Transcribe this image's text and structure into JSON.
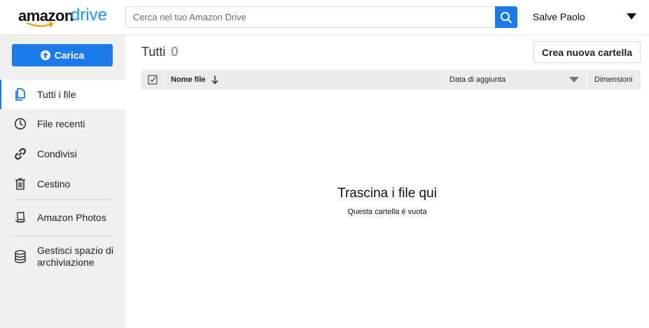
{
  "header": {
    "logo_amazon": "amazon",
    "logo_drive": "drive",
    "search_placeholder": "Cerca nel tuo Amazon Drive",
    "greeting": "Salve Paolo"
  },
  "sidebar": {
    "upload_label": "Carica",
    "items": [
      {
        "label": "Tutti i file",
        "icon": "files-icon",
        "active": true
      },
      {
        "label": "File recenti",
        "icon": "clock-icon"
      },
      {
        "label": "Condivisi",
        "icon": "link-icon"
      },
      {
        "label": "Cestino",
        "icon": "trash-icon"
      },
      {
        "label": "Amazon Photos",
        "icon": "photos-icon"
      },
      {
        "label": "Gestisci spazio di archiviazione",
        "icon": "storage-icon"
      }
    ]
  },
  "main": {
    "title": "Tutti",
    "count": "0",
    "new_folder_label": "Crea nuova cartella",
    "columns": {
      "name": "Nome file",
      "date": "Data di aggiunta",
      "size": "Dimensioni"
    },
    "empty_title": "Trascina i file qui",
    "empty_subtitle": "Questa cartella è vuota"
  },
  "colors": {
    "accent": "#1c7bec",
    "sidebar_bg": "#f0f0f0",
    "table_header_bg": "#ececec"
  }
}
